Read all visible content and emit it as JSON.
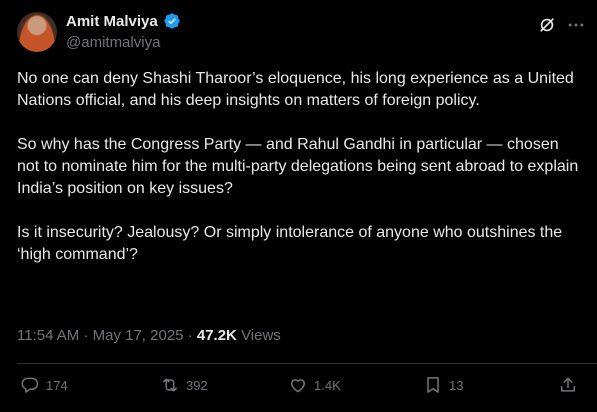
{
  "author": {
    "display_name": "Amit Malviya",
    "handle": "@amitmalviya",
    "verified": true
  },
  "tweet": {
    "paragraphs": [
      "No one can deny Shashi Tharoor’s eloquence, his long experience as a United Nations official, and his deep insights on matters of foreign policy.",
      "So why has the Congress Party — and Rahul Gandhi in particular — chosen not to nominate him for the multi-party delegations being sent abroad to explain India’s position on key issues?",
      "Is it insecurity? Jealousy? Or simply intolerance of anyone who outshines the ‘high command’?"
    ]
  },
  "meta": {
    "time": "11:54 AM",
    "separator": "·",
    "date": "May 17, 2025",
    "views_count": "47.2K",
    "views_label": "Views"
  },
  "actions": {
    "replies": "174",
    "reposts": "392",
    "likes": "1.4K",
    "bookmarks": "13"
  },
  "colors": {
    "background": "#000000",
    "text_primary": "#e7e9ea",
    "text_secondary": "#71767b",
    "verified": "#1d9bf0",
    "divider": "#2f3336"
  },
  "icons": [
    "verified-badge-icon",
    "grok-icon",
    "more-icon",
    "reply-icon",
    "repost-icon",
    "like-icon",
    "bookmark-icon",
    "share-icon"
  ]
}
